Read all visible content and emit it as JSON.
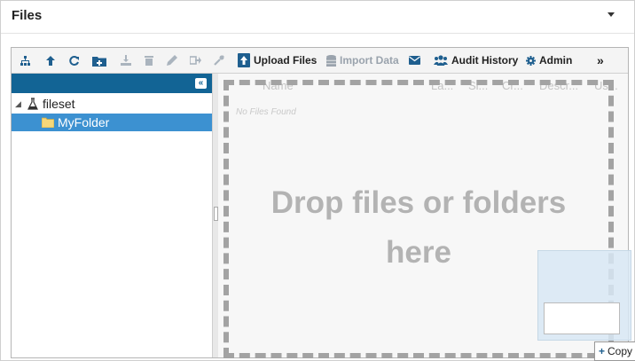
{
  "panel": {
    "title": "Files"
  },
  "toolbar": {
    "upload_files": "Upload Files",
    "import_data": "Import Data",
    "audit_history": "Audit History",
    "admin": "Admin",
    "more": "»"
  },
  "tree": {
    "collapse_glyph": "«",
    "root": {
      "label": "fileset",
      "expanded": true
    },
    "child": {
      "label": "MyFolder",
      "selected": true
    }
  },
  "grid": {
    "columns": [
      "Name",
      "La...",
      "Si...",
      "Cr...",
      "Descr...",
      "Us..."
    ],
    "empty_text": "No Files Found"
  },
  "dropzone": {
    "line1": "Drop files or folders",
    "line2": "here"
  },
  "drag": {
    "tooltip": "Copy"
  },
  "colors": {
    "tree_header": "#126495",
    "selection": "#3c91d1",
    "accent": "#1f5f8f"
  }
}
